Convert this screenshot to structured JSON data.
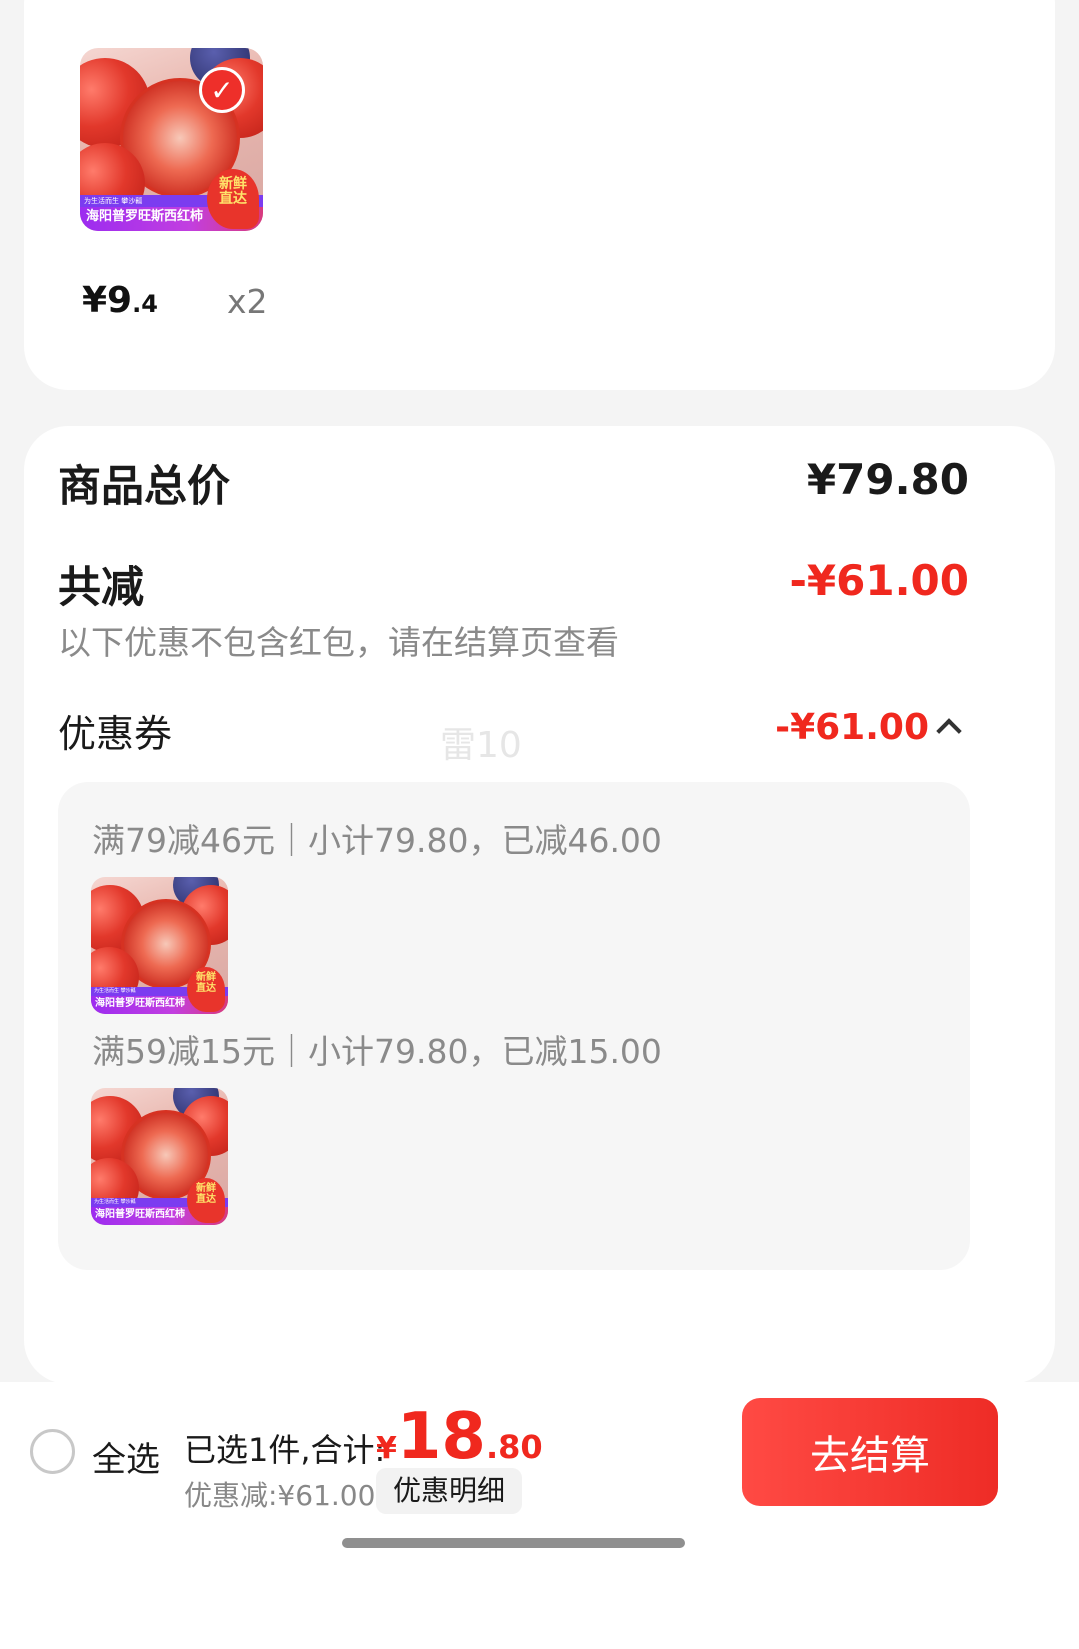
{
  "product": {
    "image_banner_text": "海阳普罗旺斯西红柿",
    "image_strip_text": "为生活而生 攀沙瓤",
    "image_badge_text": "新鲜\n直达",
    "price_integer": "¥9",
    "price_decimal": ".4",
    "quantity": "x2",
    "selected": true
  },
  "summary": {
    "goods_total_label": "商品总价",
    "goods_total_value": "¥79.80",
    "discount_label": "共减",
    "discount_value": "-¥61.00",
    "discount_note": "以下优惠不包含红包，请在结算页查看",
    "coupon_label": "优惠券",
    "coupon_value": "-¥61.00",
    "watermark": "雷10"
  },
  "coupon_rules": [
    {
      "text": "满79减46元｜小计79.80，已减46.00"
    },
    {
      "text": "满59减15元｜小计79.80，已减15.00"
    }
  ],
  "bottom_bar": {
    "select_all_label": "全选",
    "selected_text": "已选1件,合计:",
    "total_symbol": "¥",
    "total_integer": "18",
    "total_decimal": ".80",
    "discount_amount": "优惠减:¥61.00",
    "detail_button": "优惠明细",
    "checkout_button": "去结算"
  },
  "colors": {
    "accent": "#f0281e",
    "checkout": "#ee2c26",
    "background": "#f4f4f4"
  }
}
